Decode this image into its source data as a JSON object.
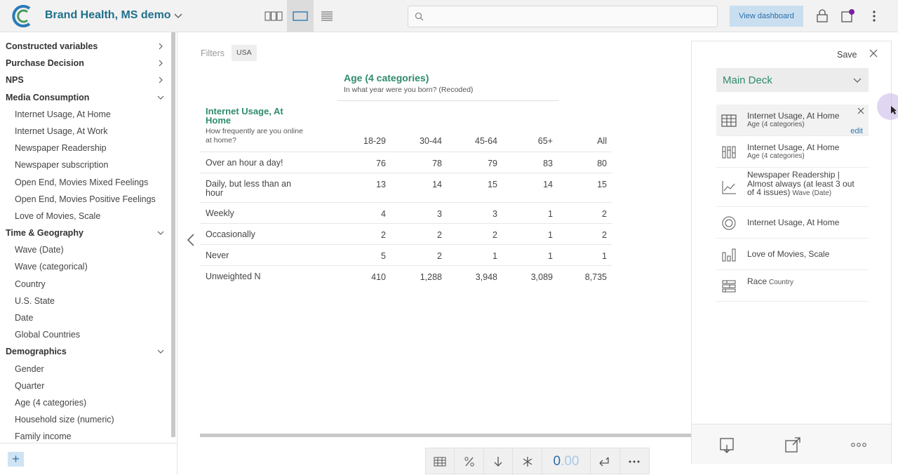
{
  "app": {
    "title": "Brand Health, MS demo",
    "search_placeholder": ""
  },
  "header": {
    "view_dashboard": "View dashboard"
  },
  "sidebar": {
    "entries": [
      {
        "type": "group",
        "label": "Constructed variables",
        "expanded": false
      },
      {
        "type": "group",
        "label": "Purchase Decision",
        "expanded": false
      },
      {
        "type": "group",
        "label": "NPS",
        "expanded": false
      },
      {
        "type": "group",
        "label": "Media Consumption",
        "expanded": true
      },
      {
        "type": "item",
        "label": "Internet Usage, At Home"
      },
      {
        "type": "item",
        "label": "Internet Usage, At Work"
      },
      {
        "type": "item",
        "label": "Newspaper Readership"
      },
      {
        "type": "item",
        "label": "Newspaper subscription"
      },
      {
        "type": "item",
        "label": "Open End, Movies Mixed Feelings"
      },
      {
        "type": "item",
        "label": "Open End, Movies Positive Feelings"
      },
      {
        "type": "item",
        "label": "Love of Movies, Scale"
      },
      {
        "type": "group",
        "label": "Time & Geography",
        "expanded": true
      },
      {
        "type": "item",
        "label": "Wave (Date)"
      },
      {
        "type": "item",
        "label": "Wave (categorical)"
      },
      {
        "type": "item",
        "label": "Country"
      },
      {
        "type": "item",
        "label": "U.S. State"
      },
      {
        "type": "item",
        "label": "Date"
      },
      {
        "type": "item",
        "label": "Global Countries"
      },
      {
        "type": "group",
        "label": "Demographics",
        "expanded": true
      },
      {
        "type": "item",
        "label": "Gender"
      },
      {
        "type": "item",
        "label": "Quarter"
      },
      {
        "type": "item",
        "label": "Age (4 categories)"
      },
      {
        "type": "item",
        "label": "Household size (numeric)"
      },
      {
        "type": "item",
        "label": "Family income"
      }
    ],
    "add_label": "+"
  },
  "filters": {
    "label": "Filters",
    "chips": [
      "USA"
    ]
  },
  "table": {
    "column_variable": "Age (4 categories)",
    "column_question": "In what year were you born? (Recoded)",
    "row_variable": "Internet Usage, At Home",
    "row_question": "How frequently are you online at home?",
    "columns": [
      "18-29",
      "30-44",
      "45-64",
      "65+",
      "All"
    ],
    "rows": [
      {
        "label": "Over an hour a day!",
        "values": [
          "76",
          "78",
          "79",
          "83",
          "80"
        ]
      },
      {
        "label": "Daily, but less than an hour",
        "values": [
          "13",
          "14",
          "15",
          "14",
          "15"
        ]
      },
      {
        "label": "Weekly",
        "values": [
          "4",
          "3",
          "3",
          "1",
          "2"
        ]
      },
      {
        "label": "Occasionally",
        "values": [
          "2",
          "2",
          "2",
          "1",
          "2"
        ]
      },
      {
        "label": "Never",
        "values": [
          "5",
          "2",
          "1",
          "1",
          "1"
        ]
      },
      {
        "label": "Unweighted N",
        "values": [
          "410",
          "1,288",
          "3,948",
          "3,089",
          "8,735"
        ]
      }
    ]
  },
  "toolbar": {
    "decimal_main": "0",
    "decimal_faint": ".00"
  },
  "panel": {
    "save": "Save",
    "deck": "Main Deck",
    "edit": "edit",
    "items": [
      {
        "icon": "table-icon",
        "title": "Internet Usage, At Home",
        "sub": "Age (4 categories)"
      },
      {
        "icon": "bar-chart-icon",
        "title": "Internet Usage, At Home",
        "sub": "Age (4 categories)"
      },
      {
        "icon": "line-chart-icon",
        "title": "Newspaper Readership | Almost always (at least 3 out of 4 issues)",
        "sub": "Wave (Date)"
      },
      {
        "icon": "donut-chart-icon",
        "title": "Internet Usage, At Home",
        "sub": ""
      },
      {
        "icon": "column-chart-icon",
        "title": "Love of Movies, Scale",
        "sub": ""
      },
      {
        "icon": "grouped-bar-icon",
        "title": "Race",
        "sub": "Country"
      }
    ]
  }
}
